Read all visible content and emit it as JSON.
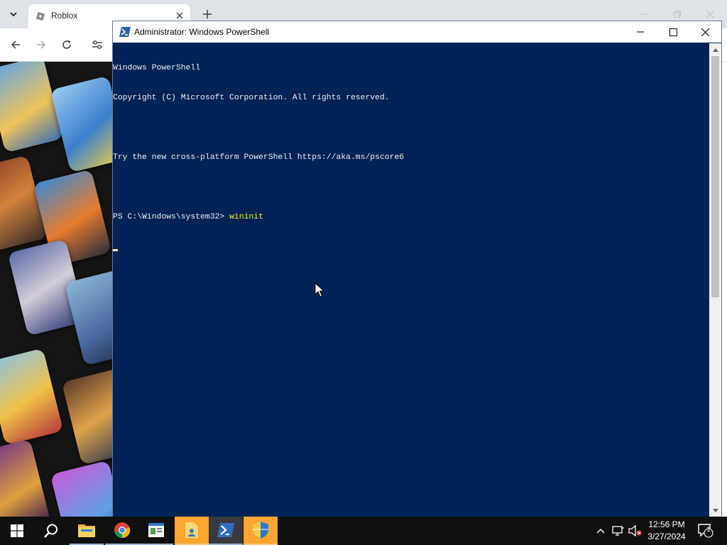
{
  "browser": {
    "tab": {
      "title": "Roblox"
    },
    "accent_color": "#dfe3e8"
  },
  "powershell": {
    "title": "Administrator: Windows PowerShell",
    "background_color": "#012456",
    "lines": [
      "Windows PowerShell",
      "Copyright (C) Microsoft Corporation. All rights reserved.",
      "",
      "Try the new cross-platform PowerShell https://aka.ms/pscore6",
      ""
    ],
    "prompt": "PS C:\\Windows\\system32> ",
    "command": "wininit"
  },
  "taskbar": {
    "items": [
      {
        "name": "start",
        "icon": "windows-logo-icon"
      },
      {
        "name": "search",
        "icon": "search-icon"
      },
      {
        "name": "file-explorer",
        "icon": "folder-icon"
      },
      {
        "name": "chrome",
        "icon": "chrome-icon"
      },
      {
        "name": "app",
        "icon": "window-app-icon"
      },
      {
        "name": "server-manager",
        "icon": "document-user-icon"
      },
      {
        "name": "powershell",
        "icon": "powershell-icon"
      },
      {
        "name": "security",
        "icon": "shield-icon"
      }
    ],
    "clock": {
      "time": "12:56 PM",
      "date": "3/27/2024"
    },
    "notification_count": "1"
  }
}
